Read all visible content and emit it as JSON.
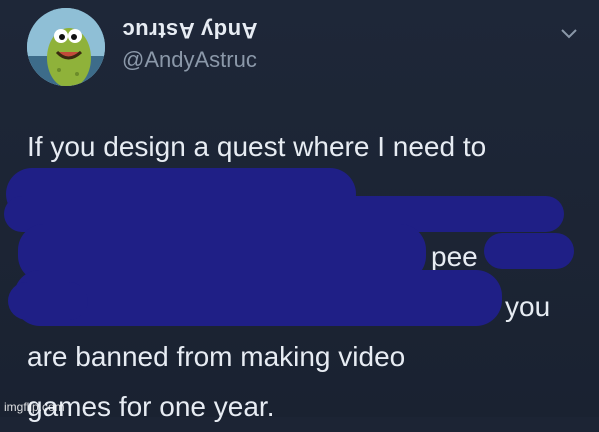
{
  "author": {
    "display_name": "Andy Astruc",
    "handle": "@AndyAstruc"
  },
  "tweet": {
    "line1": "If you design a quest where I need to",
    "fragment_pee": "pee",
    "fragment_you": "you",
    "line4": "are banned from making video",
    "line5": "games for one year."
  },
  "watermark": "imgflip.com",
  "colors": {
    "background": "#1c2434",
    "text": "#e7ecf3",
    "handle": "#8b98a9",
    "redaction": "#1f1f86"
  },
  "icons": {
    "menu": "chevron-down-icon",
    "avatar": "cartoon-pickle-avatar"
  }
}
